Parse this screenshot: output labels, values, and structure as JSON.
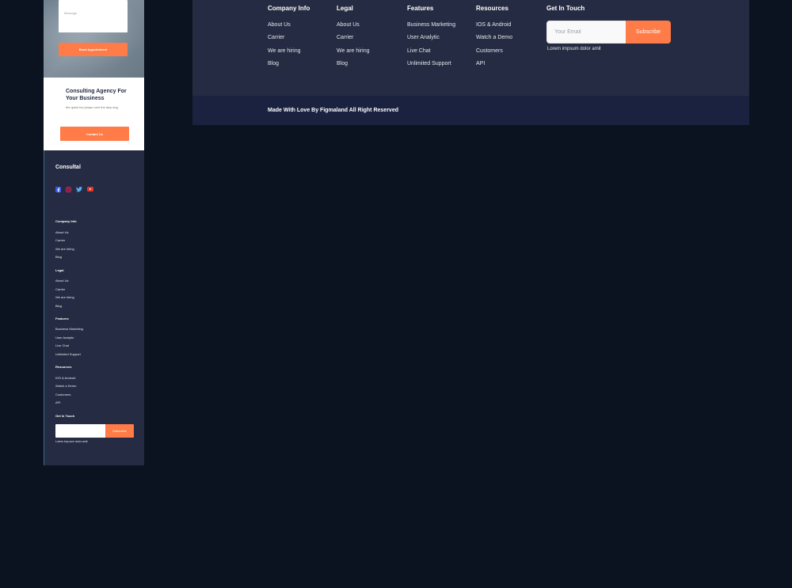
{
  "mobile": {
    "message_placeholder": "Message",
    "book_button": "Book Appointment",
    "cta": {
      "title": "Consulting Agency For Your Business",
      "subtitle": "the quick fox jumps over the lazy dog",
      "button": "Contact Us"
    },
    "footer": {
      "brand": "Consultal",
      "social_icons": [
        "facebook-icon",
        "instagram-icon",
        "twitter-icon",
        "youtube-icon"
      ],
      "columns": [
        {
          "title": "Company Info",
          "links": [
            "About Us",
            "Carrier",
            "We are hiring",
            "Blog"
          ]
        },
        {
          "title": "Legal",
          "links": [
            "About Us",
            "Carrier",
            "We are hiring",
            "Blog"
          ]
        },
        {
          "title": "Features",
          "links": [
            "Business Marketing",
            "User Analytic",
            "Live Chat",
            "Unlimited Support"
          ]
        },
        {
          "title": "Resources",
          "links": [
            "IOS & Android",
            "Watch a Demo",
            "Customers",
            "API"
          ]
        }
      ],
      "get_in_touch": "Get In Touch",
      "subscribe": "Subscribe",
      "note": "Lorem imp sum dolor amit"
    }
  },
  "desktop": {
    "columns": [
      {
        "title": "Company Info",
        "links": [
          "About Us",
          "Carrier",
          "We are hiring",
          "Blog"
        ]
      },
      {
        "title": "Legal",
        "links": [
          "About Us",
          "Carrier",
          "We are hiring",
          "Blog"
        ]
      },
      {
        "title": "Features",
        "links": [
          "Business Marketing",
          "User Analytic",
          "Live Chat",
          "Unlimited Support"
        ]
      },
      {
        "title": "Resources",
        "links": [
          "IOS & Android",
          "Watch a Demo",
          "Customers",
          "API"
        ]
      }
    ],
    "get_in_touch": "Get In Touch",
    "email_placeholder": "Your Email",
    "subscribe": "Subscribe",
    "note": "Lorem impsum dolor amit",
    "copyright": "Made With Love By Figmaland All Right Reserved"
  },
  "colors": {
    "accent": "#ff7b47",
    "footer_bg": "#252b42",
    "bottom_bar": "#1a2240",
    "page_bg": "#0b1320"
  }
}
